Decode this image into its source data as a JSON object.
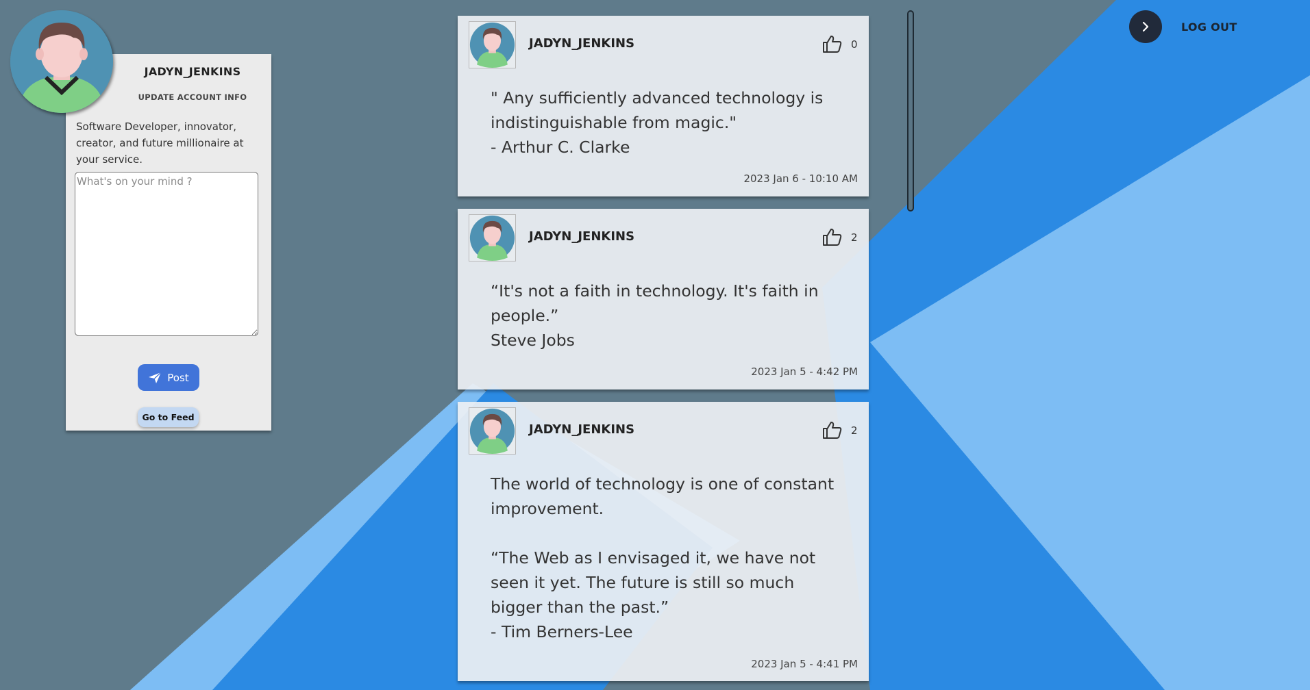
{
  "profile": {
    "username": "JADYN_JENKINS",
    "update_label": "UPDATE ACCOUNT INFO",
    "bio": "Software Developer, innovator, creator, and future millionaire at your service.",
    "textarea_placeholder": "What's on your mind ?",
    "post_label": "Post",
    "feed_label": "Go to Feed"
  },
  "header": {
    "logout_label": "LOG OUT",
    "logout_icon": "chevron-right-icon"
  },
  "posts": [
    {
      "username": "JADYN_JENKINS",
      "likes": "0",
      "body": "\" Any sufficiently advanced technology is indistinguishable from magic.\"\n- Arthur C. Clarke",
      "timestamp": "2023 Jan 6 - 10:10 AM"
    },
    {
      "username": "JADYN_JENKINS",
      "likes": "2",
      "body": "“It's not a faith in technology. It's faith in people.”\nSteve Jobs",
      "timestamp": "2023 Jan 5 - 4:42 PM"
    },
    {
      "username": "JADYN_JENKINS",
      "likes": "2",
      "body": "The world of technology is one of constant improvement.\n\n“The Web as I envisaged it, we have not seen it yet. The future is still so much bigger than the past.”\n- Tim Berners-Lee",
      "timestamp": "2023 Jan 5 - 4:41 PM"
    }
  ],
  "colors": {
    "background": "#5f7b8b",
    "accent_blue": "#2b8ae3",
    "light_blue": "#7dbdf4",
    "post_button": "#4174d9",
    "feed_button": "#c3d8f2"
  }
}
